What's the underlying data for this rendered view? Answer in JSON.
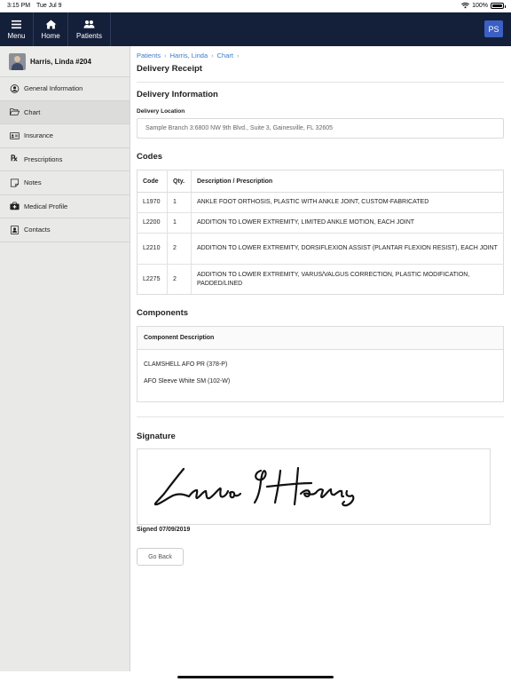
{
  "status_bar": {
    "time": "3:15 PM",
    "date": "Tue Jul 9",
    "battery": "100%"
  },
  "nav": {
    "menu_label": "Menu",
    "home_label": "Home",
    "patients_label": "Patients",
    "user_initials": "PS",
    "background": "#14203a"
  },
  "sidebar": {
    "patient_name": "Harris, Linda #204",
    "items": [
      {
        "label": "General Information",
        "icon": "user-circle-icon"
      },
      {
        "label": "Chart",
        "icon": "folder-open-icon"
      },
      {
        "label": "Insurance",
        "icon": "id-card-icon"
      },
      {
        "label": "Prescriptions",
        "icon": "rx-icon"
      },
      {
        "label": "Notes",
        "icon": "note-icon"
      },
      {
        "label": "Medical Profile",
        "icon": "medical-kit-icon"
      },
      {
        "label": "Contacts",
        "icon": "contact-book-icon"
      }
    ]
  },
  "breadcrumb": {
    "items": [
      "Patients",
      "Harris, Linda",
      "Chart"
    ],
    "separator": "›"
  },
  "page_title": "Delivery Receipt",
  "delivery": {
    "section_title": "Delivery Information",
    "location_label": "Delivery Location",
    "location_value": "Sample Branch 3:6800 NW 9th Blvd., Suite 3, Gainesville, FL 32605"
  },
  "codes": {
    "section_title": "Codes",
    "headers": [
      "Code",
      "Qty.",
      "Description / Prescription"
    ],
    "rows": [
      {
        "code": "L1970",
        "qty": "1",
        "desc": "ANKLE FOOT ORTHOSIS, PLASTIC WITH ANKLE JOINT, CUSTOM-FABRICATED"
      },
      {
        "code": "L2200",
        "qty": "1",
        "desc": "ADDITION TO LOWER EXTREMITY, LIMITED ANKLE MOTION, EACH JOINT"
      },
      {
        "code": "L2210",
        "qty": "2",
        "desc": "ADDITION TO LOWER EXTREMITY, DORSIFLEXION ASSIST (PLANTAR FLEXION RESIST), EACH JOINT"
      },
      {
        "code": "L2275",
        "qty": "2",
        "desc": "ADDITION TO LOWER EXTREMITY, VARUS/VALGUS CORRECTION, PLASTIC MODIFICATION, PADDED/LINED"
      }
    ]
  },
  "components": {
    "section_title": "Components",
    "header": "Component Description",
    "items": [
      "CLAMSHELL AFO PR (378-P)",
      "AFO Sleeve White SM (102-W)"
    ]
  },
  "signature": {
    "section_title": "Signature",
    "signature_text": "Linda Harris",
    "signed_label": "Signed 07/09/2019"
  },
  "go_back_label": "Go Back",
  "colors": {
    "link": "#3a7bc8",
    "accent": "#3b5fc4"
  }
}
